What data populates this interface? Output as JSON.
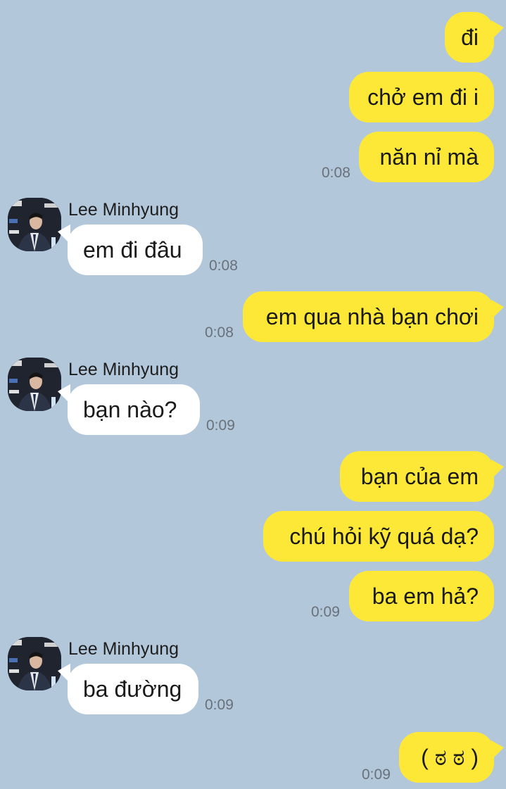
{
  "sender_name": "Lee Minhyung",
  "messages": {
    "m1": {
      "text": "đi"
    },
    "m2": {
      "text": "chở em đi i"
    },
    "m3": {
      "text": "năn nỉ mà",
      "time": "0:08"
    },
    "m4": {
      "text": "em đi đâu",
      "time": "0:08"
    },
    "m5": {
      "text": "em qua nhà bạn chơi",
      "time": "0:08"
    },
    "m6": {
      "text": "bạn nào?",
      "time": "0:09"
    },
    "m7": {
      "text": "bạn của em"
    },
    "m8": {
      "text": "chú hỏi kỹ quá dạ?"
    },
    "m9": {
      "text": "ba em hả?",
      "time": "0:09"
    },
    "m10": {
      "text": "ba đường",
      "time": "0:09"
    },
    "m11": {
      "text": "( ಠ ಠ )",
      "time": "0:09"
    }
  },
  "colors": {
    "background": "#b2c7da",
    "outgoing_bubble": "#fee837",
    "incoming_bubble": "#ffffff",
    "timestamp": "#69717a"
  }
}
